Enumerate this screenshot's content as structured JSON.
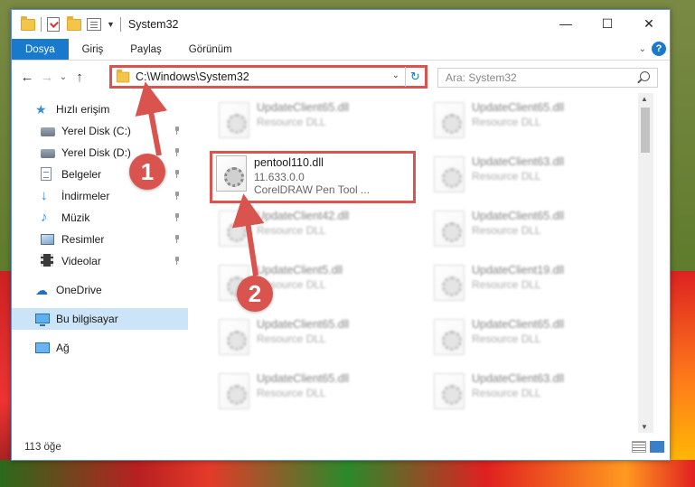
{
  "window": {
    "title": "System32"
  },
  "ribbon": {
    "tabs": [
      "Dosya",
      "Giriş",
      "Paylaş",
      "Görünüm"
    ]
  },
  "address": {
    "path": "C:\\Windows\\System32"
  },
  "search": {
    "placeholder": "Ara: System32"
  },
  "sidebar": {
    "quick_access": "Hızlı erişim",
    "items": [
      {
        "label": "Yerel Disk (C:)"
      },
      {
        "label": "Yerel Disk (D:)"
      },
      {
        "label": "Belgeler"
      },
      {
        "label": "İndirmeler"
      },
      {
        "label": "Müzik"
      },
      {
        "label": "Resimler"
      },
      {
        "label": "Videolar"
      }
    ],
    "onedrive": "OneDrive",
    "this_pc": "Bu bilgisayar",
    "network": "Ağ"
  },
  "files": {
    "col1": [
      {
        "name": "UpdateClient65.dll",
        "sub": "Resource DLL"
      },
      {
        "name": "pentool110.dll",
        "version": "11.633.0.0",
        "desc": "CorelDRAW Pen Tool ..."
      },
      {
        "name": "UpdateClient42.dll",
        "sub": "Resource DLL"
      },
      {
        "name": "UpdateClient5.dll",
        "sub": "Resource DLL"
      },
      {
        "name": "UpdateClient65.dll",
        "sub": "Resource DLL"
      },
      {
        "name": "UpdateClient65.dll",
        "sub": "Resource DLL"
      }
    ],
    "col2": [
      {
        "name": "UpdateClient65.dll",
        "sub": "Resource DLL"
      },
      {
        "name": "UpdateClient63.dll",
        "sub": "Resource DLL"
      },
      {
        "name": "UpdateClient65.dll",
        "sub": "Resource DLL"
      },
      {
        "name": "UpdateClient19.dll",
        "sub": "Resource DLL"
      },
      {
        "name": "UpdateClient65.dll",
        "sub": "Resource DLL"
      },
      {
        "name": "UpdateClient63.dll",
        "sub": "Resource DLL"
      }
    ]
  },
  "status": {
    "count": "113 öğe"
  },
  "annotations": {
    "step1": "1",
    "step2": "2",
    "color": "#d9534f"
  }
}
